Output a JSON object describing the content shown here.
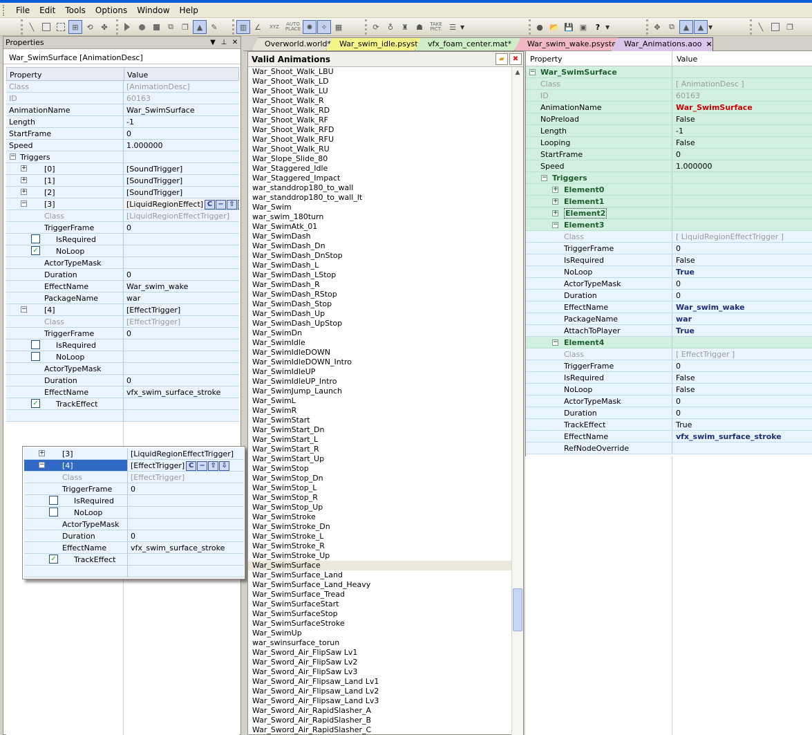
{
  "menubar": [
    "File",
    "Edit",
    "Tools",
    "Options",
    "Window",
    "Help"
  ],
  "toolbar": {
    "auto_place": "AUTO PLACE",
    "take_pict": "TAKE PICT.",
    "xyz": "XYZ"
  },
  "properties_panel": {
    "title": "Properties",
    "object_label": "War_SwimSurface [AnimationDesc]",
    "col_property": "Property",
    "col_value": "Value",
    "rows": [
      {
        "p": "Class",
        "v": "[AnimationDesc]",
        "grey": true
      },
      {
        "p": "ID",
        "v": "60163",
        "grey": true
      },
      {
        "p": "AnimationName",
        "v": "War_SwimSurface"
      },
      {
        "p": "Length",
        "v": "-1"
      },
      {
        "p": "StartFrame",
        "v": "0"
      },
      {
        "p": "Speed",
        "v": "1.000000"
      },
      {
        "p": "Triggers",
        "v": "",
        "exp": "−",
        "lvl": 0
      },
      {
        "p": "[0]",
        "v": "[SoundTrigger]",
        "exp": "+",
        "lvl": 1
      },
      {
        "p": "[1]",
        "v": "[SoundTrigger]",
        "exp": "+",
        "lvl": 1
      },
      {
        "p": "[2]",
        "v": "[SoundTrigger]",
        "exp": "+",
        "lvl": 1
      },
      {
        "p": "[3]",
        "v": "[LiquidRegionEffect]",
        "exp": "−",
        "lvl": 1,
        "tools": true
      },
      {
        "p": "Class",
        "v": "[LiquidRegionEffectTrigger]",
        "grey": true,
        "lvl": 2
      },
      {
        "p": "TriggerFrame",
        "v": "0",
        "lvl": 2
      },
      {
        "p": "IsRequired",
        "v": "",
        "lvl": 2,
        "check": false
      },
      {
        "p": "NoLoop",
        "v": "",
        "lvl": 2,
        "check": true
      },
      {
        "p": "ActorTypeMask",
        "v": "",
        "lvl": 2
      },
      {
        "p": "Duration",
        "v": "0",
        "lvl": 2
      },
      {
        "p": "EffectName",
        "v": "War_swim_wake",
        "lvl": 2
      },
      {
        "p": "PackageName",
        "v": "war",
        "lvl": 2
      },
      {
        "p": "[4]",
        "v": "[EffectTrigger]",
        "exp": "−",
        "lvl": 1
      },
      {
        "p": "Class",
        "v": "[EffectTrigger]",
        "grey": true,
        "lvl": 2
      },
      {
        "p": "TriggerFrame",
        "v": "0",
        "lvl": 2
      },
      {
        "p": "IsRequired",
        "v": "",
        "lvl": 2,
        "check": false
      },
      {
        "p": "NoLoop",
        "v": "",
        "lvl": 2,
        "check": false
      },
      {
        "p": "ActorTypeMask",
        "v": "",
        "lvl": 2
      },
      {
        "p": "Duration",
        "v": "0",
        "lvl": 2
      },
      {
        "p": "EffectName",
        "v": "vfx_swim_surface_stroke",
        "lvl": 2
      },
      {
        "p": "TrackEffect",
        "v": "",
        "lvl": 2,
        "check": true
      }
    ]
  },
  "floating_panel": {
    "rows": [
      {
        "p": "[3]",
        "v": "[LiquidRegionEffectTrigger]",
        "exp": "+",
        "lvl": 1
      },
      {
        "p": "[4]",
        "v": "[EffectTrigger]",
        "exp": "−",
        "lvl": 1,
        "tools": true,
        "selected": true
      },
      {
        "p": "Class",
        "v": "[EffectTrigger]",
        "grey": true,
        "lvl": 2
      },
      {
        "p": "TriggerFrame",
        "v": "0",
        "lvl": 2
      },
      {
        "p": "IsRequired",
        "v": "",
        "lvl": 2,
        "check": false
      },
      {
        "p": "NoLoop",
        "v": "",
        "lvl": 2,
        "check": false
      },
      {
        "p": "ActorTypeMask",
        "v": "",
        "lvl": 2
      },
      {
        "p": "Duration",
        "v": "0",
        "lvl": 2
      },
      {
        "p": "EffectName",
        "v": "vfx_swim_surface_stroke",
        "lvl": 2
      },
      {
        "p": "TrackEffect",
        "v": "",
        "lvl": 2,
        "check": true
      }
    ]
  },
  "tabs": [
    {
      "label": "Overworld.world*",
      "color": "#e6e3d6"
    },
    {
      "label": "War_swim_idle.psystem*",
      "color": "#f6f58a"
    },
    {
      "label": "vfx_foam_center.mat*",
      "color": "#cfeec8"
    },
    {
      "label": "War_swim_wake.psystem",
      "color": "#f2b9c2"
    },
    {
      "label": "War_Animations.aoo",
      "color": "#d9c6ea",
      "active": true,
      "close": "×"
    }
  ],
  "valid_animations": {
    "title": "Valid Animations",
    "selected": "War_SwimSurface",
    "items": [
      "War_Shoot_Walk_LBU",
      "War_Shoot_Walk_LD",
      "War_Shoot_Walk_LU",
      "War_Shoot_Walk_R",
      "War_Shoot_Walk_RD",
      "War_Shoot_Walk_RF",
      "War_Shoot_Walk_RFD",
      "War_Shoot_Walk_RFU",
      "War_Shoot_Walk_RU",
      "War_Slope_Slide_80",
      "War_Staggered_Idle",
      "War_Staggered_Impact",
      "war_standdrop180_to_wall",
      "war_standdrop180_to_wall_lt",
      "War_Swim",
      "war_swim_180turn",
      "War_SwimAtk_01",
      "War_SwimDash",
      "War_SwimDash_Dn",
      "War_SwimDash_DnStop",
      "War_SwimDash_L",
      "War_SwimDash_LStop",
      "War_SwimDash_R",
      "War_SwimDash_RStop",
      "War_SwimDash_Stop",
      "War_SwimDash_Up",
      "War_SwimDash_UpStop",
      "War_SwimDn",
      "War_SwimIdle",
      "War_SwimIdleDOWN",
      "War_SwimIdleDOWN_Intro",
      "War_SwimIdleUP",
      "War_SwimIdleUP_Intro",
      "War_SwimJump_Launch",
      "War_SwimL",
      "War_SwimR",
      "War_SwimStart",
      "War_SwimStart_Dn",
      "War_SwimStart_L",
      "War_SwimStart_R",
      "War_SwimStart_Up",
      "War_SwimStop",
      "War_SwimStop_Dn",
      "War_SwimStop_L",
      "War_SwimStop_R",
      "War_SwimStop_Up",
      "War_SwimStroke",
      "War_SwimStroke_Dn",
      "War_SwimStroke_L",
      "War_SwimStroke_R",
      "War_SwimStroke_Up",
      "War_SwimSurface",
      "War_SwimSurface_Land",
      "War_SwimSurface_Land_Heavy",
      "War_SwimSurface_Tread",
      "War_SwimSurfaceStart",
      "War_SwimSurfaceStop",
      "War_SwimSurfaceStroke",
      "War_SwimUp",
      "war_swinsurface_torun",
      "War_Sword_Air_FlipSaw Lv1",
      "War_Sword_Air_FlipSaw Lv2",
      "War_Sword_Air_FlipSaw Lv3",
      "War_Sword_Air_Flipsaw_Land Lv1",
      "War_Sword_Air_Flipsaw_Land Lv2",
      "War_Sword_Air_Flipsaw_Land Lv3",
      "War_Sword_Air_RapidSlasher_A",
      "War_Sword_Air_RapidSlasher_B",
      "War_Sword_Air_RapidSlasher_C"
    ]
  },
  "right_grid": {
    "col_property": "Property",
    "col_value": "Value",
    "rows": [
      {
        "p": "War_SwimSurface",
        "v": "",
        "lvl": 0,
        "exp": "−",
        "head": true
      },
      {
        "p": "Class",
        "v": "[ AnimationDesc ]",
        "lvl": 1,
        "grey": true
      },
      {
        "p": "ID",
        "v": "60163",
        "lvl": 1,
        "grey": true
      },
      {
        "p": "AnimationName",
        "v": "War_SwimSurface",
        "lvl": 1,
        "style": "red"
      },
      {
        "p": "NoPreload",
        "v": "False",
        "lvl": 1
      },
      {
        "p": "Length",
        "v": "-1",
        "lvl": 1
      },
      {
        "p": "Looping",
        "v": "False",
        "lvl": 1
      },
      {
        "p": "StartFrame",
        "v": "0",
        "lvl": 1
      },
      {
        "p": "Speed",
        "v": "1.000000",
        "lvl": 1
      },
      {
        "p": "Triggers",
        "v": "",
        "lvl": 1,
        "exp": "−",
        "head": true
      },
      {
        "p": "Element0",
        "v": "",
        "lvl": 2,
        "exp": "+",
        "head": true
      },
      {
        "p": "Element1",
        "v": "",
        "lvl": 2,
        "exp": "+",
        "head": true
      },
      {
        "p": "Element2",
        "v": "",
        "lvl": 2,
        "exp": "+",
        "head": true,
        "boxed": true
      },
      {
        "p": "Element3",
        "v": "",
        "lvl": 2,
        "exp": "−",
        "head": true
      },
      {
        "p": "Class",
        "v": "[ LiquidRegionEffectTrigger ]",
        "lvl": 3,
        "grey": true,
        "white": true
      },
      {
        "p": "TriggerFrame",
        "v": "0",
        "lvl": 3,
        "white": true
      },
      {
        "p": "IsRequired",
        "v": "False",
        "lvl": 3,
        "white": true
      },
      {
        "p": "NoLoop",
        "v": "True",
        "lvl": 3,
        "white": true,
        "style": "navy"
      },
      {
        "p": "ActorTypeMask",
        "v": "0",
        "lvl": 3,
        "white": true
      },
      {
        "p": "Duration",
        "v": "0",
        "lvl": 3,
        "white": true
      },
      {
        "p": "EffectName",
        "v": "War_swim_wake",
        "lvl": 3,
        "white": true,
        "style": "navy"
      },
      {
        "p": "PackageName",
        "v": "war",
        "lvl": 3,
        "white": true,
        "style": "navy"
      },
      {
        "p": "AttachToPlayer",
        "v": "True",
        "lvl": 3,
        "white": true,
        "style": "navy"
      },
      {
        "p": "Element4",
        "v": "",
        "lvl": 2,
        "exp": "−",
        "head": true
      },
      {
        "p": "Class",
        "v": "[ EffectTrigger ]",
        "lvl": 3,
        "grey": true,
        "white": true
      },
      {
        "p": "TriggerFrame",
        "v": "0",
        "lvl": 3,
        "white": true
      },
      {
        "p": "IsRequired",
        "v": "False",
        "lvl": 3,
        "white": true
      },
      {
        "p": "NoLoop",
        "v": "False",
        "lvl": 3,
        "white": true
      },
      {
        "p": "ActorTypeMask",
        "v": "0",
        "lvl": 3,
        "white": true
      },
      {
        "p": "Duration",
        "v": "0",
        "lvl": 3,
        "white": true
      },
      {
        "p": "TrackEffect",
        "v": "True",
        "lvl": 3,
        "white": true
      },
      {
        "p": "EffectName",
        "v": "vfx_swim_surface_stroke",
        "lvl": 3,
        "white": true,
        "style": "navy"
      },
      {
        "p": "RefNodeOverride",
        "v": "",
        "lvl": 3,
        "white": true
      }
    ]
  }
}
